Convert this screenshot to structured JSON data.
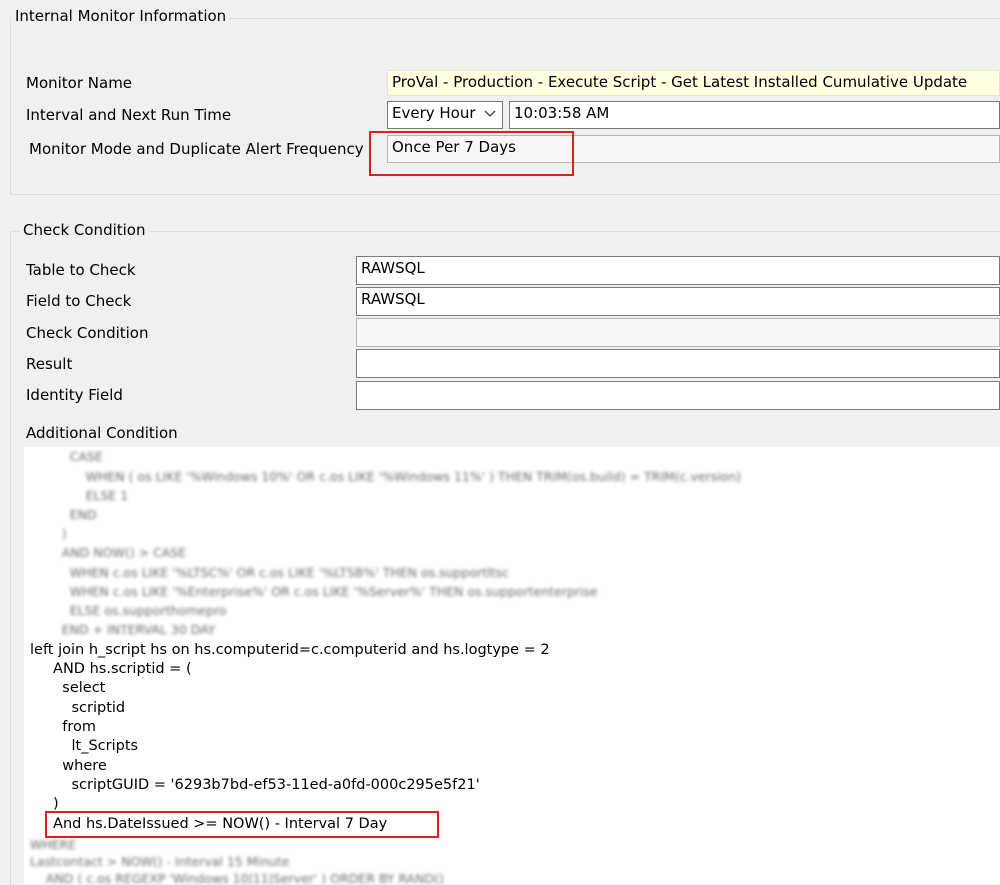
{
  "internal_monitor": {
    "title": "Internal Monitor Information",
    "monitor_name_label": "Monitor Name",
    "monitor_name_value": "ProVal - Production - Execute Script - Get Latest Installed Cumulative Update",
    "interval_label": "Interval and Next Run Time",
    "interval_value": "Every Hour",
    "next_run_time": "10:03:58 AM",
    "mode_label": "Monitor Mode and Duplicate Alert Frequency",
    "mode_value": "Once Per 7 Days"
  },
  "check_condition": {
    "title": "Check Condition",
    "table_label": "Table to Check",
    "table_value": "RAWSQL",
    "field_label": "Field to Check",
    "field_value": "RAWSQL",
    "condition_label": "Check Condition",
    "condition_value": "",
    "result_label": "Result",
    "result_value": "",
    "identity_label": "Identity Field",
    "identity_value": "",
    "additional_label": "Additional Condition"
  },
  "code": {
    "lines": [
      "left join h_script hs on hs.computerid=c.computerid and hs.logtype = 2",
      "     AND hs.scriptid = (",
      "       select",
      "         scriptid",
      "       from",
      "         lt_Scripts",
      "       where",
      "         scriptGUID = '6293b7bd-ef53-11ed-a0fd-000c295e5f21'",
      "     )",
      "     And hs.DateIssued >= NOW() - Interval 7 Day"
    ],
    "blurred_top": [
      "          CASE",
      "              WHEN ( os LIKE '%Windows 10%' OR c.os LIKE '%Windows 11%' ) THEN TRIM(os.build) = TRIM(c.version)",
      "              ELSE 1",
      "          END",
      "        )",
      "        AND NOW() > CASE",
      "          WHEN c.os LIKE '%LTSC%' OR c.os LIKE '%LTSB%' THEN os.supportltsc",
      "          WHEN c.os LIKE '%Enterprise%' OR c.os LIKE '%Server%' THEN os.supportenterprise",
      "          ELSE os.supporthomepro",
      "        END + INTERVAL 30 DAY"
    ],
    "blurred_bottom": [
      "WHERE",
      "Lastcontact > NOW() - Interval 15 Minute",
      "    AND ( c.os REGEXP 'Windows 10|11|Server' ) ORDER BY RAND()"
    ]
  }
}
